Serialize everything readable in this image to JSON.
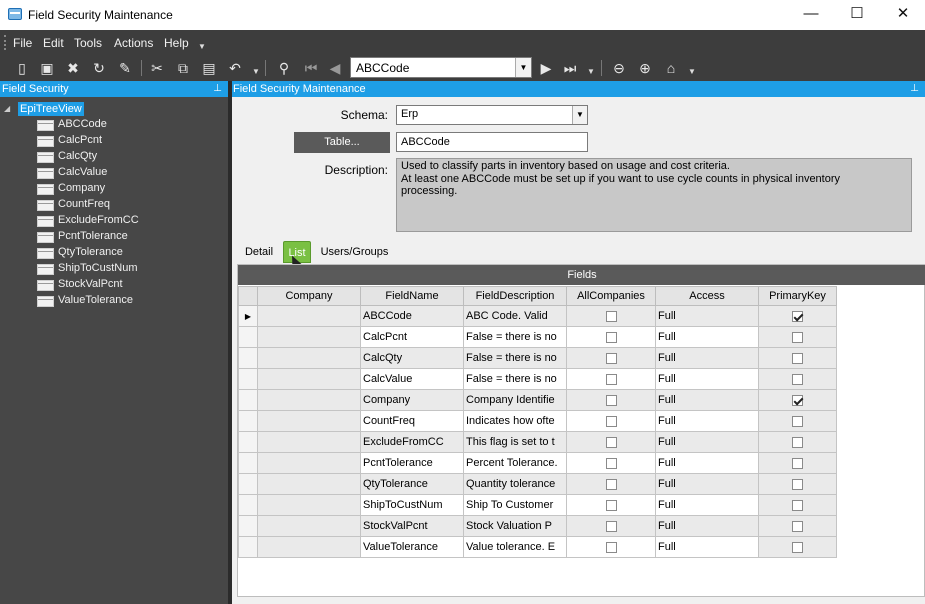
{
  "window": {
    "title": "Field Security Maintenance",
    "minimize": "—",
    "maximize": "☐",
    "close": "✕"
  },
  "menu": [
    "File",
    "Edit",
    "Tools",
    "Actions",
    "Help"
  ],
  "toolbar": {
    "key_value": "ABCCode"
  },
  "left_panel": {
    "title": "Field Security",
    "root": "EpiTreeView",
    "items": [
      "ABCCode",
      "CalcPcnt",
      "CalcQty",
      "CalcValue",
      "Company",
      "CountFreq",
      "ExcludeFromCC",
      "PcntTolerance",
      "QtyTolerance",
      "ShipToCustNum",
      "StockValPcnt",
      "ValueTolerance"
    ]
  },
  "right_panel": {
    "title": "Field Security Maintenance",
    "schema_label": "Schema:",
    "schema_value": "Erp",
    "table_button": "Table...",
    "table_value": "ABCCode",
    "description_label": "Description:",
    "description_line1": "Used to classify parts in inventory based on usage and cost criteria.",
    "description_line2": "At least one ABCCode must be set up if you want to use cycle counts in physical inventory",
    "description_line3": "processing."
  },
  "tabs": {
    "detail": "Detail",
    "list": "List",
    "users": "Users/Groups"
  },
  "grid": {
    "caption": "Fields",
    "columns": [
      "Company",
      "FieldName",
      "FieldDescription",
      "AllCompanies",
      "Access",
      "PrimaryKey"
    ],
    "rows": [
      {
        "company": "",
        "field": "ABCCode",
        "desc": "ABC Code.  Valid",
        "all": false,
        "access": "Full",
        "pk": true
      },
      {
        "company": "",
        "field": "CalcPcnt",
        "desc": "False = there is no",
        "all": false,
        "access": "Full",
        "pk": false
      },
      {
        "company": "",
        "field": "CalcQty",
        "desc": "False = there is no",
        "all": false,
        "access": "Full",
        "pk": false
      },
      {
        "company": "",
        "field": "CalcValue",
        "desc": "False = there is no",
        "all": false,
        "access": "Full",
        "pk": false
      },
      {
        "company": "",
        "field": "Company",
        "desc": "Company Identifie",
        "all": false,
        "access": "Full",
        "pk": true
      },
      {
        "company": "",
        "field": "CountFreq",
        "desc": "Indicates how ofte",
        "all": false,
        "access": "Full",
        "pk": false
      },
      {
        "company": "",
        "field": "ExcludeFromCC",
        "desc": "This flag is set to t",
        "all": false,
        "access": "Full",
        "pk": false
      },
      {
        "company": "",
        "field": "PcntTolerance",
        "desc": "Percent Tolerance.",
        "all": false,
        "access": "Full",
        "pk": false
      },
      {
        "company": "",
        "field": "QtyTolerance",
        "desc": "Quantity tolerance",
        "all": false,
        "access": "Full",
        "pk": false
      },
      {
        "company": "",
        "field": "ShipToCustNum",
        "desc": "Ship To Customer",
        "all": false,
        "access": "Full",
        "pk": false
      },
      {
        "company": "",
        "field": "StockValPcnt",
        "desc": "Stock Valuation P",
        "all": false,
        "access": "Full",
        "pk": false
      },
      {
        "company": "",
        "field": "ValueTolerance",
        "desc": "Value tolerance. E",
        "all": false,
        "access": "Full",
        "pk": false
      }
    ]
  }
}
